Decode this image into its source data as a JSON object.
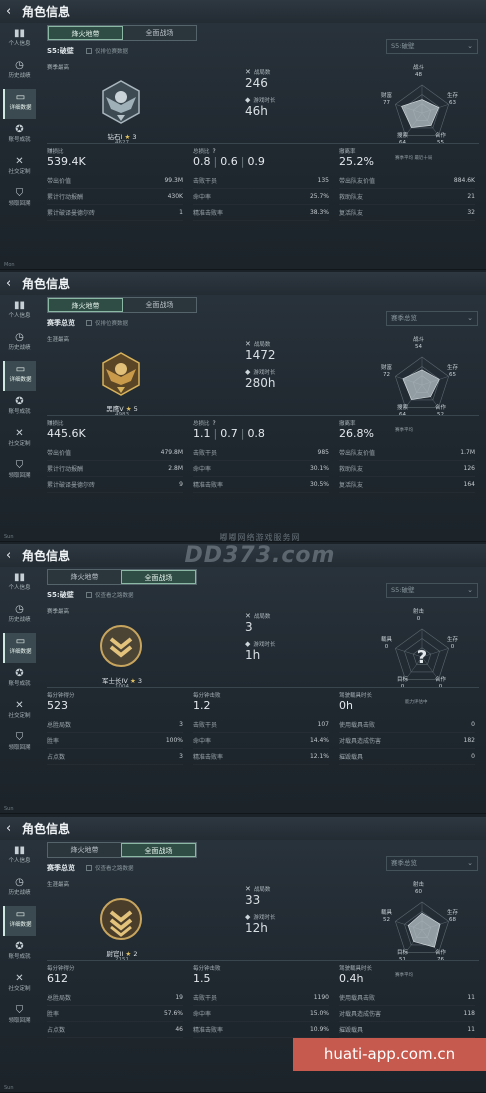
{
  "header": {
    "title": "角色信息"
  },
  "sidebar": [
    {
      "label": "个人信息",
      "icon": "bar-chart-icon"
    },
    {
      "label": "历史战绩",
      "icon": "history-icon"
    },
    {
      "label": "详细数据",
      "icon": "folder-icon"
    },
    {
      "label": "账号成就",
      "icon": "medal-icon"
    },
    {
      "label": "社交定制",
      "icon": "tools-icon"
    },
    {
      "label": "领取回溯",
      "icon": "shield-icon"
    }
  ],
  "panels": [
    {
      "tabs": [
        "烽火地带",
        "全面战场"
      ],
      "selected_tab": 0,
      "season": "S5:破壁",
      "checkbox": "仅排位赛数据",
      "dropdown": "S5:破壁",
      "sec_label": "赛季最高",
      "badge_style": "eagle",
      "rank": "钻石I",
      "stars": "3",
      "rank_points": "4627",
      "mid": [
        {
          "label": "战局数",
          "value": "246"
        },
        {
          "label": "游戏时长",
          "value": "46h"
        }
      ],
      "radar": {
        "labels": {
          "top": "战斗",
          "upper_left": "财富",
          "upper_right": "生存",
          "lower_left": "搜索",
          "lower_right": "合作"
        },
        "values": {
          "top": "48",
          "upper_left": "77",
          "upper_right": "63",
          "lower_left": "64",
          "lower_right": "55"
        },
        "legend_a": "赛季平均",
        "legend_b": "最近十局",
        "unknown": false,
        "unknown_label": ""
      },
      "cols": [
        {
          "head_label": "赚损比",
          "head_parts": [
            "539.4K"
          ],
          "rows": [
            [
              "带出价值",
              "99.3M"
            ],
            [
              "累计行动报酬",
              "430K"
            ],
            [
              "累计破译曼德尔砖",
              "1"
            ]
          ]
        },
        {
          "head_label": "总损比",
          "head_parts": [
            "0.8",
            "0.6",
            "0.9"
          ],
          "head_q": true,
          "rows": [
            [
              "击败干员",
              "135"
            ],
            [
              "命中率",
              "25.7%"
            ],
            [
              "精准击败率",
              "38.3%"
            ]
          ]
        },
        {
          "head_label": "撤离率",
          "head_parts": [
            "25.2%"
          ],
          "rows": [
            [
              "带出队友价值",
              "884.6K"
            ],
            [
              "救助队友",
              "21"
            ],
            [
              "复活队友",
              "32"
            ]
          ]
        }
      ],
      "footer": "Mon"
    },
    {
      "tabs": [
        "烽火地带",
        "全面战场"
      ],
      "selected_tab": 0,
      "season": "赛季总览",
      "checkbox": "仅排位赛数据",
      "dropdown": "赛季总览",
      "sec_label": "生涯最高",
      "badge_style": "eagle-gold",
      "rank": "黑鹰V",
      "stars": "5",
      "rank_points": "4983",
      "mid": [
        {
          "label": "战局数",
          "value": "1472"
        },
        {
          "label": "游戏时长",
          "value": "280h"
        }
      ],
      "radar": {
        "labels": {
          "top": "战斗",
          "upper_left": "财富",
          "upper_right": "生存",
          "lower_left": "搜索",
          "lower_right": "合作"
        },
        "values": {
          "top": "54",
          "upper_left": "72",
          "upper_right": "65",
          "lower_left": "64",
          "lower_right": "52"
        },
        "legend_a": "赛季平均",
        "legend_b": "",
        "unknown": false,
        "unknown_label": ""
      },
      "cols": [
        {
          "head_label": "赚损比",
          "head_parts": [
            "445.6K"
          ],
          "rows": [
            [
              "带出价值",
              "479.8M"
            ],
            [
              "累计行动报酬",
              "2.8M"
            ],
            [
              "累计破译曼德尔砖",
              "9"
            ]
          ]
        },
        {
          "head_label": "总损比",
          "head_parts": [
            "1.1",
            "0.7",
            "0.8"
          ],
          "head_q": true,
          "rows": [
            [
              "击败干员",
              "985"
            ],
            [
              "命中率",
              "30.1%"
            ],
            [
              "精准击败率",
              "30.5%"
            ]
          ]
        },
        {
          "head_label": "撤离率",
          "head_parts": [
            "26.8%"
          ],
          "rows": [
            [
              "带出队友价值",
              "1.7M"
            ],
            [
              "救助队友",
              "126"
            ],
            [
              "复活队友",
              "164"
            ]
          ]
        }
      ],
      "footer": "Sun"
    },
    {
      "tabs": [
        "烽火地带",
        "全面战场"
      ],
      "selected_tab": 1,
      "season": "S5:破壁",
      "checkbox": "仅查看之路数据",
      "dropdown": "S5:破壁",
      "sec_label": "赛季最高",
      "badge_style": "chevron",
      "rank": "军士长IV",
      "stars": "3",
      "rank_points": "1004",
      "mid": [
        {
          "label": "战局数",
          "value": "3"
        },
        {
          "label": "游戏时长",
          "value": "1h"
        }
      ],
      "radar": {
        "labels": {
          "top": "射击",
          "upper_left": "载具",
          "upper_right": "生存",
          "lower_left": "目标",
          "lower_right": "合作"
        },
        "values": {
          "top": "0",
          "upper_left": "0",
          "upper_right": "0",
          "lower_left": "0",
          "lower_right": "0"
        },
        "legend_a": "",
        "legend_b": "",
        "unknown": true,
        "unknown_label": "能力评估中"
      },
      "cols": [
        {
          "head_label": "每分钟得分",
          "head_parts": [
            "523"
          ],
          "rows": [
            [
              "总胜局数",
              "3"
            ],
            [
              "胜率",
              "100%"
            ],
            [
              "占点数",
              "3"
            ]
          ]
        },
        {
          "head_label": "每分钟击败",
          "head_parts": [
            "1.2"
          ],
          "head_q": false,
          "rows": [
            [
              "击败干员",
              "107"
            ],
            [
              "命中率",
              "14.4%"
            ],
            [
              "精准击败率",
              "12.1%"
            ]
          ]
        },
        {
          "head_label": "驾驶载具时长",
          "head_parts": [
            "0h"
          ],
          "rows": [
            [
              "使用载具击败",
              "0"
            ],
            [
              "对载具造成伤害",
              "182"
            ],
            [
              "摧毁载具",
              "0"
            ]
          ]
        }
      ],
      "footer": "Sun"
    },
    {
      "tabs": [
        "烽火地带",
        "全面战场"
      ],
      "selected_tab": 1,
      "season": "赛季总览",
      "checkbox": "仅查看之路数据",
      "dropdown": "赛季总览",
      "sec_label": "生涯最高",
      "badge_style": "chevron-gold",
      "rank": "尉官II",
      "stars": "2",
      "rank_points": "2151",
      "mid": [
        {
          "label": "战局数",
          "value": "33"
        },
        {
          "label": "游戏时长",
          "value": "12h"
        }
      ],
      "radar": {
        "labels": {
          "top": "射击",
          "upper_left": "载具",
          "upper_right": "生存",
          "lower_left": "目标",
          "lower_right": "合作"
        },
        "values": {
          "top": "60",
          "upper_left": "52",
          "upper_right": "68",
          "lower_left": "51",
          "lower_right": "76"
        },
        "legend_a": "赛季平均",
        "legend_b": "",
        "unknown": false,
        "unknown_label": ""
      },
      "cols": [
        {
          "head_label": "每分钟得分",
          "head_parts": [
            "612"
          ],
          "rows": [
            [
              "总胜局数",
              "19"
            ],
            [
              "胜率",
              "57.6%"
            ],
            [
              "占点数",
              "46"
            ]
          ]
        },
        {
          "head_label": "每分钟击败",
          "head_parts": [
            "1.5"
          ],
          "head_q": false,
          "rows": [
            [
              "击败干员",
              "1190"
            ],
            [
              "命中率",
              "15.0%"
            ],
            [
              "精准击败率",
              "10.9%"
            ]
          ]
        },
        {
          "head_label": "驾驶载具时长",
          "head_parts": [
            "0.4h"
          ],
          "rows": [
            [
              "使用载具击败",
              "11"
            ],
            [
              "对载具造成伤害",
              "118"
            ],
            [
              "摧毁载具",
              "11"
            ]
          ]
        }
      ],
      "footer": "Sun"
    }
  ],
  "watermark": {
    "main": "DD373.com",
    "sub": "嘟嘟网络游戏服务网"
  },
  "corner_watermark": "huati-app.com.cn",
  "colors": {
    "accent": "#8ab8a5",
    "panel_bg": "#202830",
    "radar_fill": "#b8c4c9"
  }
}
